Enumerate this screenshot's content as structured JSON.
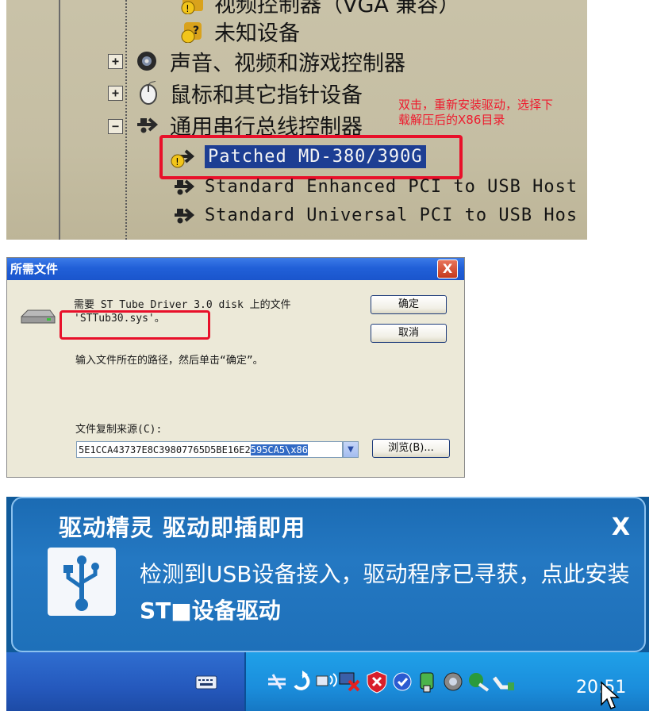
{
  "panel1": {
    "tree_items": [
      {
        "label": "视频控制器（VGA 兼容）",
        "state": "warning"
      },
      {
        "label": "未知设备",
        "state": "warning"
      },
      {
        "label": "声音、视频和游戏控制器",
        "expander": "+"
      },
      {
        "label": "鼠标和其它指针设备",
        "expander": "+"
      },
      {
        "label": "通用串行总线控制器",
        "expander": "−"
      },
      {
        "label": "Patched MD-380/390G",
        "state": "warning-selected"
      },
      {
        "label": "Standard Enhanced PCI to USB Host",
        "state": "normal"
      },
      {
        "label": "Standard Universal PCI to USB Hos",
        "state": "normal"
      }
    ],
    "annotation": "双击，重新安装驱动，选择下载解压后的X86目录"
  },
  "panel2": {
    "title": "所需文件",
    "close_label": "X",
    "message_line1": "需要 ST Tube Driver 3.0 disk 上的文件",
    "message_line2": "'STTub30.sys'。",
    "instruction": "输入文件所在的路径，然后单击“确定”。",
    "source_label": "文件复制来源(C):",
    "path_value_plain": "5E1CCA43737E8C39807765D5BE16E2",
    "path_value_selected": "595CA5\\x86",
    "ok_label": "确定",
    "cancel_label": "取消",
    "browse_label": "浏览(B)..."
  },
  "panel3": {
    "balloon_title": "驱动精灵 驱动即插即用",
    "close_label": "X",
    "message": "检测到USB设备接入，驱动程序已寻获，点此安装",
    "message_line2": "ST■设备驱动",
    "clock": "20:51"
  },
  "colors": {
    "annotation_red": "#e8102a",
    "selection_blue": "#1d3e93",
    "xp_title_blue": "#2160d8",
    "balloon_blue": "#2478c2"
  }
}
